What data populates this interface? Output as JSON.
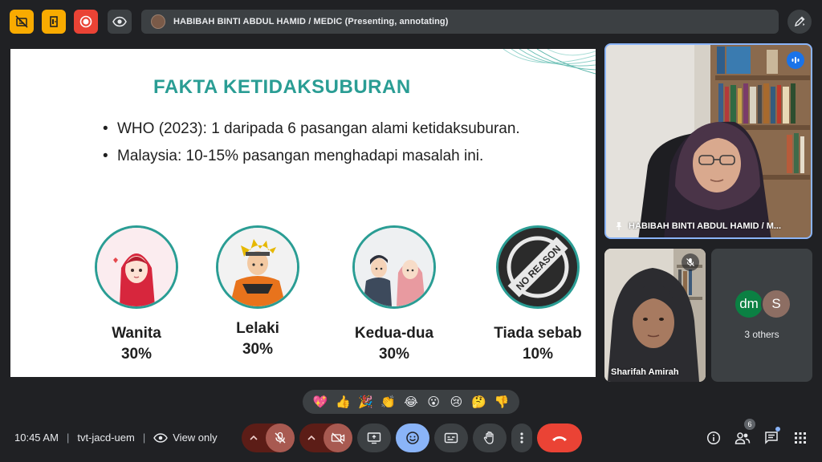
{
  "topbar": {
    "presenter_text": "HABIBAH BINTI ABDUL HAMID / MEDIC (Presenting, annotating)",
    "icons": [
      "captions-off-icon",
      "door-icon",
      "record-icon",
      "eye-icon",
      "pen-icon"
    ],
    "colors": {
      "yellow": "#f9ab00",
      "red": "#ea4335"
    }
  },
  "slide": {
    "title": "FAKTA KETIDAKSUBURAN",
    "bullets": [
      "WHO (2023): 1 daripada 6 pasangan alami ketidaksuburan.",
      "Malaysia: 10-15% pasangan menghadapi masalah ini."
    ],
    "categories": [
      {
        "label": "Wanita",
        "percent": "30%"
      },
      {
        "label": "Lelaki",
        "percent": "30%"
      },
      {
        "label": "Kedua-dua",
        "percent": "30%"
      },
      {
        "label": "Tiada sebab",
        "percent": "10%"
      }
    ],
    "no_reason_text": "NO REASON",
    "accent_color": "#2a9d94"
  },
  "participants": {
    "main": {
      "name": "HABIBAH BINTI ABDUL HAMID / M..."
    },
    "second": {
      "name": "Sharifah Amirah"
    },
    "others": {
      "avatar1": "dm",
      "avatar2": "S",
      "label": "3 others",
      "avatar1_color": "#0b8043",
      "avatar2_color": "#8d6e63"
    }
  },
  "reactions": [
    "💖",
    "👍",
    "🎉",
    "👏",
    "😂",
    "😮",
    "😢",
    "🤔",
    "👎"
  ],
  "bottom": {
    "time": "10:45 AM",
    "meeting_code": "tvt-jacd-uem",
    "view_only": "View only",
    "people_count": "6"
  }
}
